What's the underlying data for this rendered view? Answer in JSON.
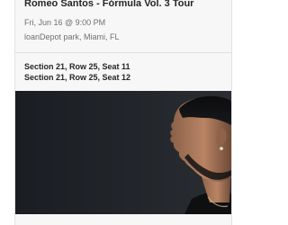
{
  "event": {
    "title": "Romeo Santos - Fórmula Vol. 3 Tour",
    "date": "Fri, Jun 16 @ 9:00 PM",
    "venue": "loanDepot park, Miami, FL"
  },
  "seats": [
    "Section 21, Row 25, Seat 11",
    "Section 21, Row 25, Seat 12"
  ],
  "photo": {
    "subject": "artist-profile-photo"
  }
}
